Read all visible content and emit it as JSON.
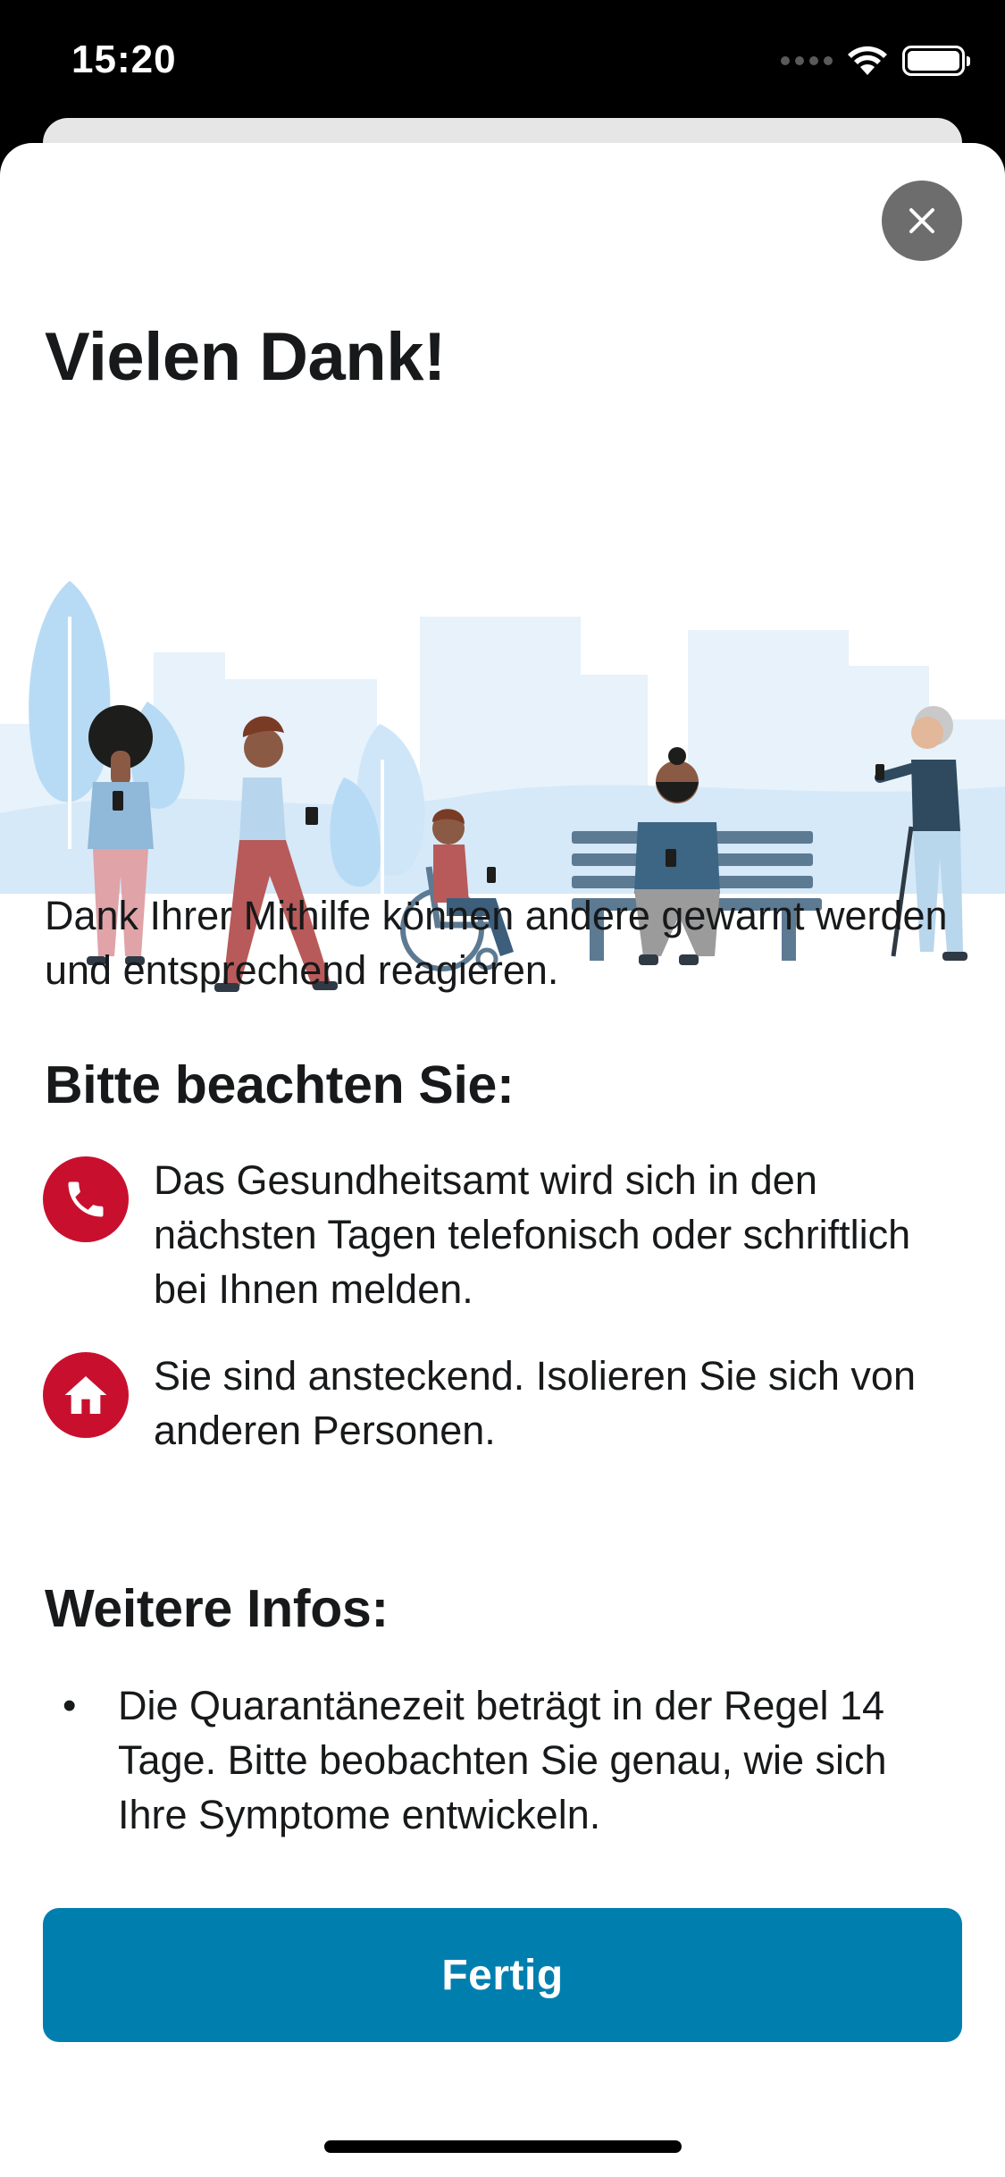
{
  "status_bar": {
    "time": "15:20",
    "icons": [
      "cellular-signal-icon",
      "wifi-icon",
      "battery-icon"
    ]
  },
  "sheet": {
    "close_icon": "close-icon",
    "title": "Vielen Dank!",
    "illustration": "people-in-park-illustration",
    "intro": "Dank Ihrer Mithilfe können andere gewarnt werden und entsprechend reagieren.",
    "note": {
      "heading": "Bitte beachten Sie:",
      "items": [
        {
          "icon": "phone-icon",
          "text": "Das Gesundheitsamt wird sich in den nächsten Tagen telefonisch oder schriftlich bei Ihnen melden."
        },
        {
          "icon": "home-icon",
          "text": "Sie sind ansteckend. Isolieren Sie sich von anderen Personen."
        }
      ]
    },
    "more": {
      "heading": "Weitere Infos:",
      "bullet": "•",
      "items": [
        "Die Quarantänezeit beträgt in der Regel 14 Tage. Bitte beobachten Sie genau, wie sich Ihre Symptome entwickeln."
      ]
    },
    "done_label": "Fertig"
  },
  "colors": {
    "accent": "#007faf",
    "alert": "#c8102e",
    "close_button": "#6d6d6d",
    "text": "#17191a"
  }
}
